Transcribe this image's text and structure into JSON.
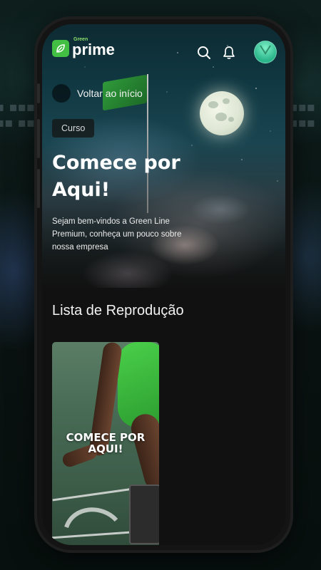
{
  "app": {
    "logo_small": "Green",
    "logo_main": "prime"
  },
  "header": {
    "search_icon": "search-icon",
    "notifications_icon": "bell-icon",
    "avatar_icon": "user-avatar"
  },
  "hero": {
    "back_label": "Voltar ao início",
    "badge": "Curso",
    "title": "Comece por Aqui!",
    "description": "Sejam bem-vindos a Green Line Premium, conheça um pouco sobre nossa empresa"
  },
  "playlist": {
    "title": "Lista de Reprodução",
    "items": [
      {
        "caption_line1": "COMECE POR",
        "caption_line2": "AQUI!"
      }
    ]
  },
  "colors": {
    "brand_green": "#43c043",
    "background": "#111111",
    "text": "#ffffff"
  }
}
